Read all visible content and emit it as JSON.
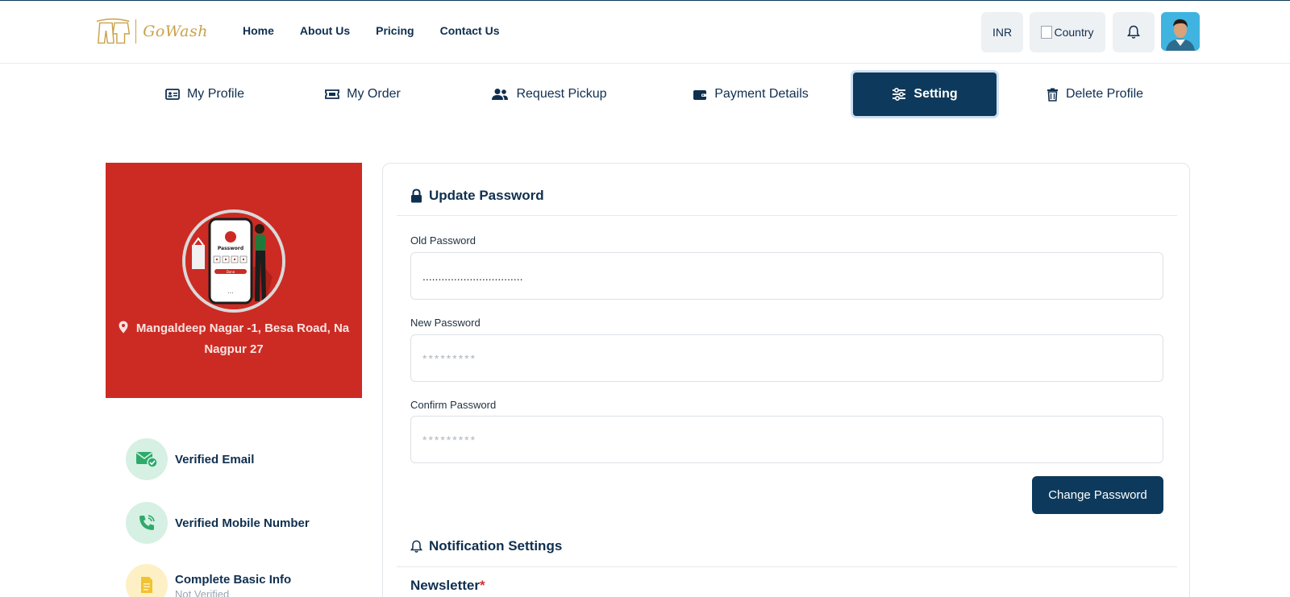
{
  "header": {
    "logo_text": "GoWash",
    "nav": [
      "Home",
      "About Us",
      "Pricing",
      "Contact Us"
    ],
    "currency": "INR",
    "country_label": "Country"
  },
  "tabs": [
    {
      "label": "My Profile",
      "icon": "id-card-icon"
    },
    {
      "label": "My Order",
      "icon": "ticket-icon"
    },
    {
      "label": "Request Pickup",
      "icon": "users-icon"
    },
    {
      "label": "Payment Details",
      "icon": "wallet-icon"
    },
    {
      "label": "Setting",
      "icon": "sliders-icon",
      "active": true
    },
    {
      "label": "Delete Profile",
      "icon": "trash-icon"
    }
  ],
  "profile": {
    "image_text": "Password",
    "image_button": "Done",
    "address_line1": "Mangaldeep Nagar -1, Besa Road, Na",
    "address_line2": "Nagpur 27",
    "card_color": "#cc2b24"
  },
  "verifications": [
    {
      "label": "Verified Email",
      "icon": "email-check-icon"
    },
    {
      "label": "Verified Mobile Number",
      "icon": "phone-icon"
    },
    {
      "label": "Complete Basic Info",
      "sub": "Not Verified",
      "icon": "document-icon"
    }
  ],
  "update_password": {
    "title": "Update Password",
    "old_label": "Old Password",
    "old_value": "................................",
    "new_label": "New Password",
    "new_placeholder": "*********",
    "confirm_label": "Confirm Password",
    "confirm_placeholder": "*********",
    "button": "Change Password"
  },
  "notification": {
    "title": "Notification Settings",
    "newsletter": "Newsletter",
    "required_mark": "*"
  },
  "colors": {
    "primary": "#0d3a5c",
    "accent_red": "#cc2b24",
    "gold": "#c9a24a"
  }
}
